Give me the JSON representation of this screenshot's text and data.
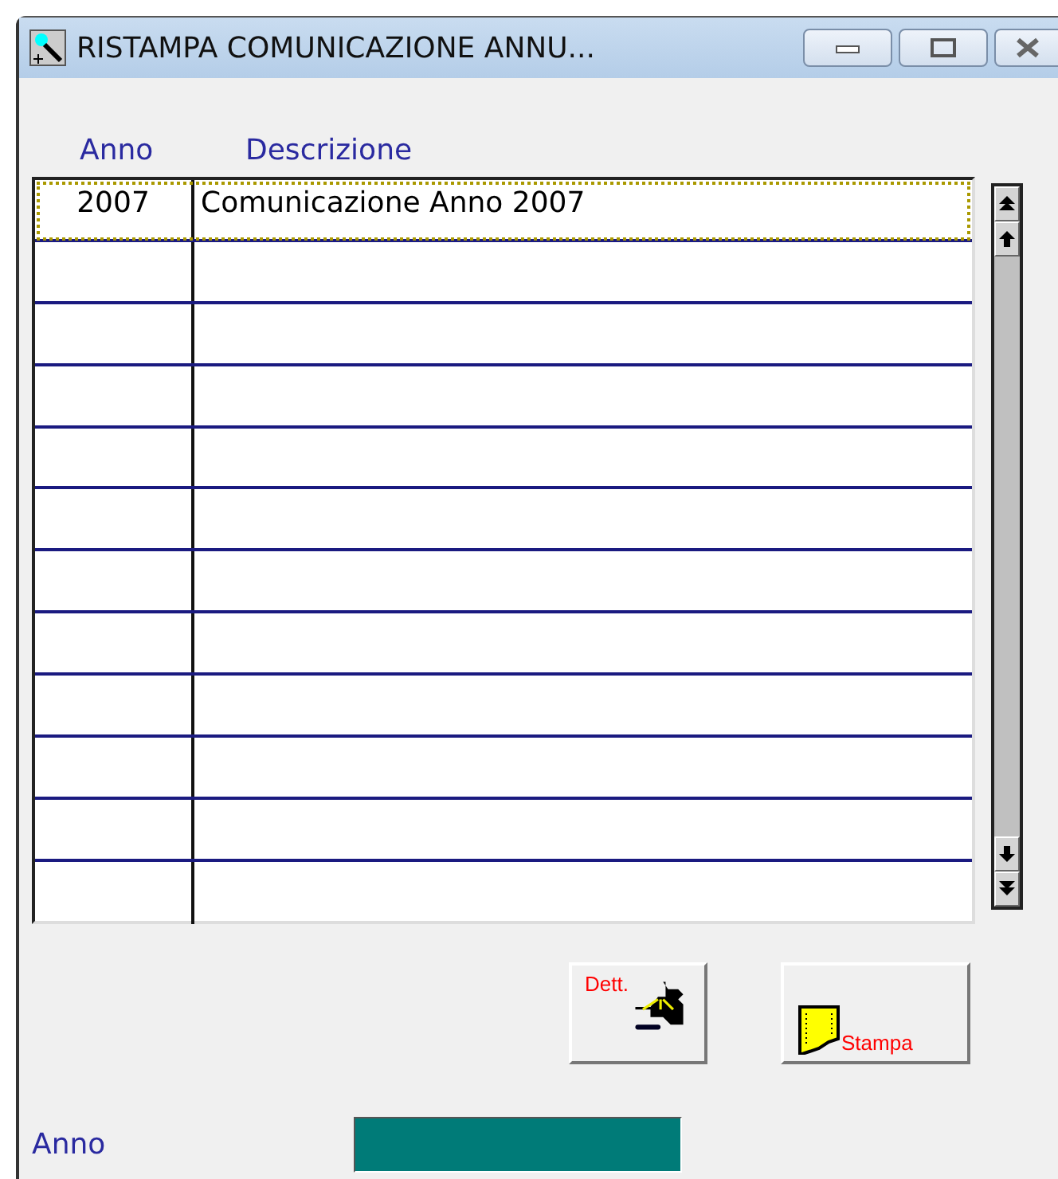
{
  "window": {
    "title": "RISTAMPA COMUNICAZIONE ANNU..."
  },
  "table": {
    "columns": [
      "Anno",
      "Descrizione"
    ],
    "rows": [
      {
        "anno": "2007",
        "descrizione": "Comunicazione Anno 2007",
        "selected": true
      }
    ]
  },
  "buttons": [
    {
      "kind": "detail",
      "label": "Dett."
    },
    {
      "kind": "print",
      "label": "Stampa"
    }
  ],
  "footer": {
    "label": "Anno"
  }
}
